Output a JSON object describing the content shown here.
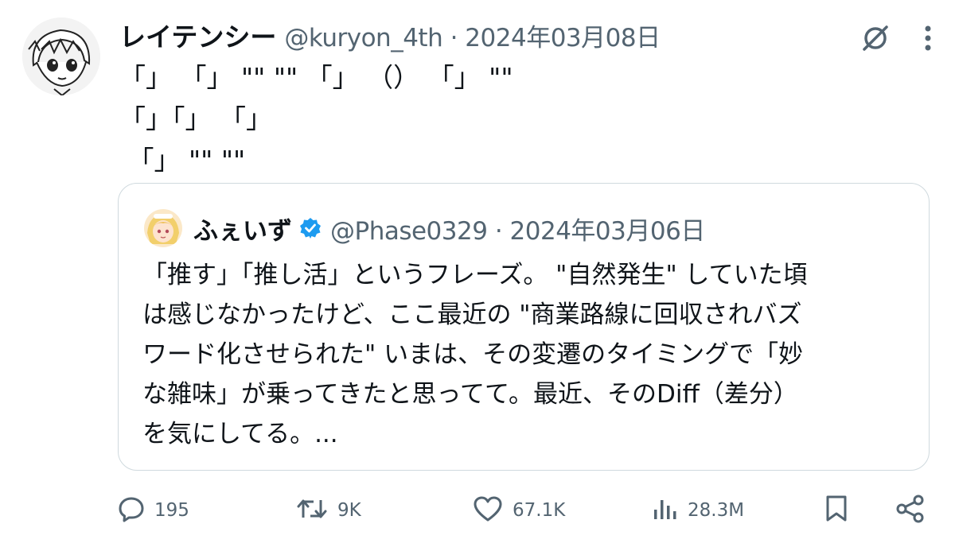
{
  "author": {
    "display_name": "レイテンシー",
    "handle": "@kuryon_4th",
    "separator": " · ",
    "date": "2024年03月08日"
  },
  "tweet_lines": [
    "「」 「」 \"\" \"\" 「」 （） 「」 \"\"",
    "「」「」 「」",
    " 「」 \"\" \"\""
  ],
  "quoted": {
    "display_name": "ふぇいず",
    "handle": "@Phase0329",
    "separator": " · ",
    "date": "2024年03月06日",
    "text_lines": [
      "「推す」「推し活」というフレーズ。 \"自然発生\" していた頃",
      "は感じなかったけど、ここ最近の \"商業路線に回収されバズ",
      "ワード化させられた\" いまは、その変遷のタイミングで「妙",
      "な雑味」が乗ってきたと思ってて。最近、そのDiff（差分）",
      "を気にしてる。..."
    ]
  },
  "actions": {
    "replies": "195",
    "reposts": "9K",
    "likes": "67.1K",
    "views": "28.3M"
  },
  "icons": {
    "grok": "grok-icon",
    "more": "more-icon",
    "reply": "reply-icon",
    "repost": "repost-icon",
    "like": "like-icon",
    "views": "views-icon",
    "bookmark": "bookmark-icon",
    "share": "share-icon",
    "verified": "verified-badge-icon"
  },
  "colors": {
    "text": "#0f1419",
    "secondary": "#536471",
    "verified": "#1d9bf0",
    "border": "#cfd9de"
  }
}
